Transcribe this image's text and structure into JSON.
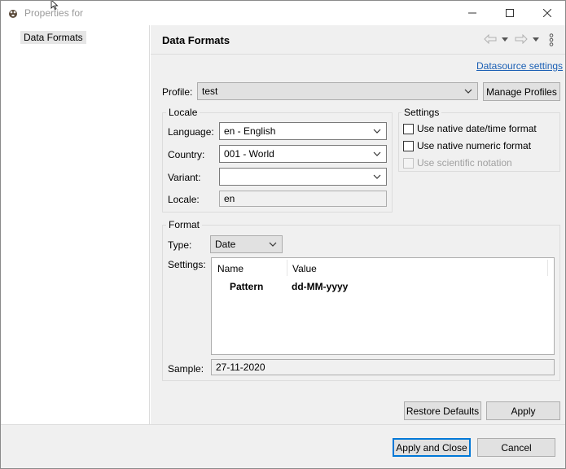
{
  "window": {
    "title": "Properties for"
  },
  "nav": {
    "items": [
      {
        "label": "Data Formats"
      }
    ]
  },
  "page": {
    "title": "Data Formats",
    "datasource_link": "Datasource settings",
    "profile": {
      "label": "Profile:",
      "value": "test",
      "manage_label": "Manage Profiles"
    },
    "locale": {
      "group_label": "Locale",
      "language_label": "Language:",
      "language_value": "en - English",
      "country_label": "Country:",
      "country_value": "001 - World",
      "variant_label": "Variant:",
      "variant_value": "",
      "locale_label": "Locale:",
      "locale_value": "en"
    },
    "settings": {
      "group_label": "Settings",
      "native_datetime": "Use native date/time format",
      "native_numeric": "Use native numeric format",
      "scientific": "Use scientific notation"
    },
    "format": {
      "group_label": "Format",
      "type_label": "Type:",
      "type_value": "Date",
      "settings_label": "Settings:",
      "columns": [
        "Name",
        "Value"
      ],
      "rows": [
        {
          "name": "Pattern",
          "value": "dd-MM-yyyy"
        }
      ],
      "sample_label": "Sample:",
      "sample_value": "27-11-2020"
    },
    "restore_label": "Restore Defaults",
    "apply_label": "Apply"
  },
  "footer": {
    "apply_close_label": "Apply and Close",
    "cancel_label": "Cancel"
  }
}
